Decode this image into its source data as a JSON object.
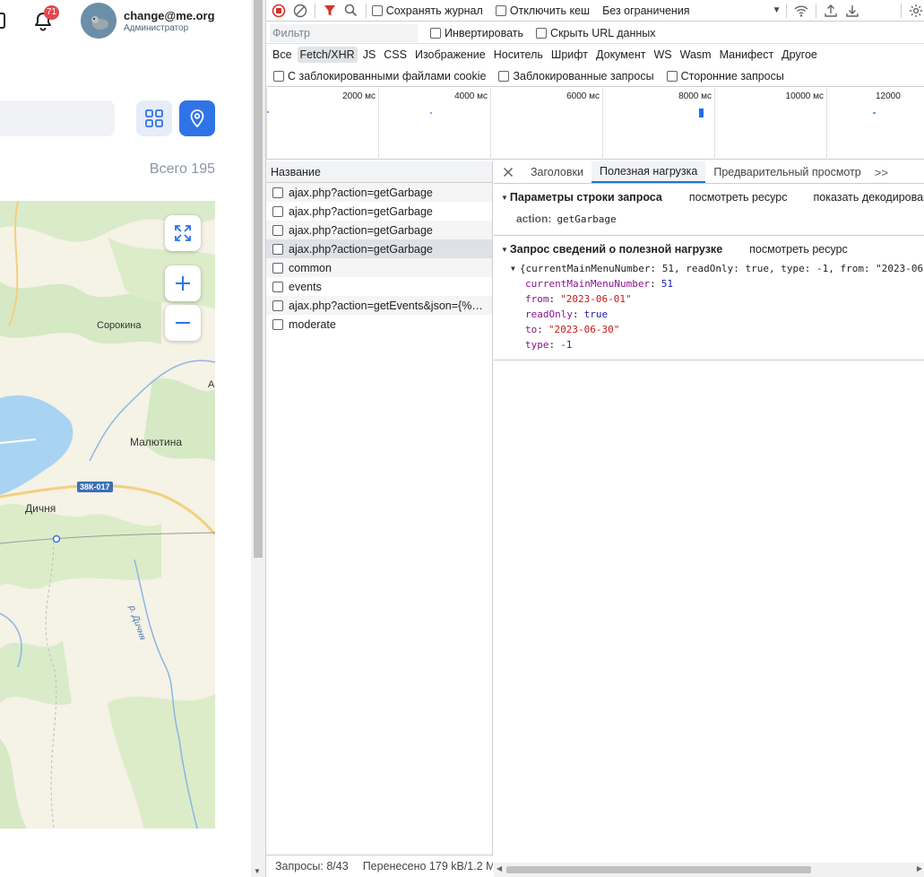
{
  "webpage": {
    "notifications": {
      "count": "71"
    },
    "user": {
      "email": "change@me.org",
      "role": "Администратор"
    },
    "total_label": "Всего 195",
    "map": {
      "places": [
        "Сорокина",
        "Малютина",
        "Дичня",
        "А"
      ],
      "road_badge": "38К-017",
      "river": "р. Дичня"
    }
  },
  "devtools": {
    "toolbar": {
      "preserve_log": "Сохранять журнал",
      "disable_cache": "Отключить кеш",
      "throttle": "Без ограничения"
    },
    "filter": {
      "placeholder": "Фильтр",
      "invert": "Инвертировать",
      "hide_data_urls": "Скрыть URL данных"
    },
    "types": [
      "Все",
      "Fetch/XHR",
      "JS",
      "CSS",
      "Изображение",
      "Носитель",
      "Шрифт",
      "Документ",
      "WS",
      "Wasm",
      "Манифест",
      "Другое"
    ],
    "active_type": "Fetch/XHR",
    "cookie_filters": [
      "С заблокированными файлами cookie",
      "Заблокированные запросы",
      "Сторонние запросы"
    ],
    "timeline": {
      "labels": [
        "2000 мс",
        "4000 мс",
        "6000 мс",
        "8000 мс",
        "10000 мс",
        "12000"
      ]
    },
    "requests": {
      "header": "Название",
      "items": [
        "ajax.php?action=getGarbage",
        "ajax.php?action=getGarbage",
        "ajax.php?action=getGarbage",
        "ajax.php?action=getGarbage",
        "common",
        "events",
        "ajax.php?action=getEvents&json={%22...",
        "moderate"
      ]
    },
    "status": {
      "requests": "Запросы: 8/43",
      "transferred": "Перенесено 179 kB/1.2 М"
    },
    "details": {
      "tabs": [
        "Заголовки",
        "Полезная нагрузка",
        "Предварительный просмотр"
      ],
      "active_tab": "Полезная нагрузка",
      "query_section": {
        "title": "Параметры строки запроса",
        "view_source": "посмотреть ресурс",
        "view_decoded": "показать декодированн",
        "params": [
          {
            "key": "action:",
            "value": "getGarbage"
          }
        ]
      },
      "payload_section": {
        "title": "Запрос сведений о полезной нагрузке",
        "view_source": "посмотреть ресурс",
        "summary": "{currentMainMenuNumber: 51, readOnly: true, type: -1, from: \"2023-06",
        "fields": [
          {
            "key": "currentMainMenuNumber",
            "value": "51",
            "kind": "num"
          },
          {
            "key": "from",
            "value": "\"2023-06-01\"",
            "kind": "str"
          },
          {
            "key": "readOnly",
            "value": "true",
            "kind": "bool"
          },
          {
            "key": "to",
            "value": "\"2023-06-30\"",
            "kind": "str"
          },
          {
            "key": "type",
            "value": "-1",
            "kind": "num"
          }
        ]
      }
    }
  }
}
